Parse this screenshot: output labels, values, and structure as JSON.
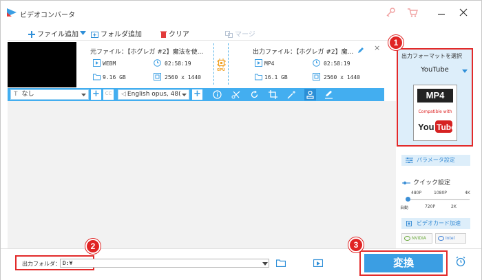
{
  "app": {
    "title": "ビデオコンバータ"
  },
  "toolbar": {
    "add_file": "ファイル追加",
    "add_folder": "フォルダ追加",
    "clear": "クリア",
    "merge": "マージ"
  },
  "file": {
    "source_label": "元ファイル：【ホグレガ #2】魔法を使...",
    "source_format": "WEBM",
    "source_duration": "02:58:19",
    "source_size": "9.16 GB",
    "source_resolution": "2560 x 1440",
    "gpu_label": "GPU",
    "output_label": "出力ファイル：【ホグレガ #2】魔...",
    "output_format": "MP4",
    "output_duration": "02:58:19",
    "output_size": "16.1 GB",
    "output_resolution": "2560 x 1440",
    "close": "×"
  },
  "editbar": {
    "subtitle_value": "なし",
    "cc_label": "CC",
    "audio_value": "English opus, 48("
  },
  "format_panel": {
    "title": "出力フォーマットを選択",
    "selected": "YouTube",
    "card_head": "MP4",
    "card_compat": "Compatible with",
    "card_brand": "YouTube",
    "param_button": "パラメータ設定",
    "quick_label": "クイック設定",
    "quality_top": [
      "480P",
      "1080P",
      "4K"
    ],
    "quality_bottom": [
      "自動",
      "720P",
      "2K"
    ],
    "quality_level": 0.02,
    "vcard_button": "ビデオカード加速",
    "badge_nvidia": "NVIDIA",
    "badge_intel": "Intel"
  },
  "bottom": {
    "output_folder_label": "出力フォルダ：",
    "output_folder_value": "D:¥",
    "convert_button": "変換"
  },
  "markers": {
    "m1": "1",
    "m2": "2",
    "m3": "3"
  },
  "colors": {
    "accent": "#3b9ee3",
    "highlight": "#e22a2a",
    "toolbar_blue": "#43aef0"
  }
}
